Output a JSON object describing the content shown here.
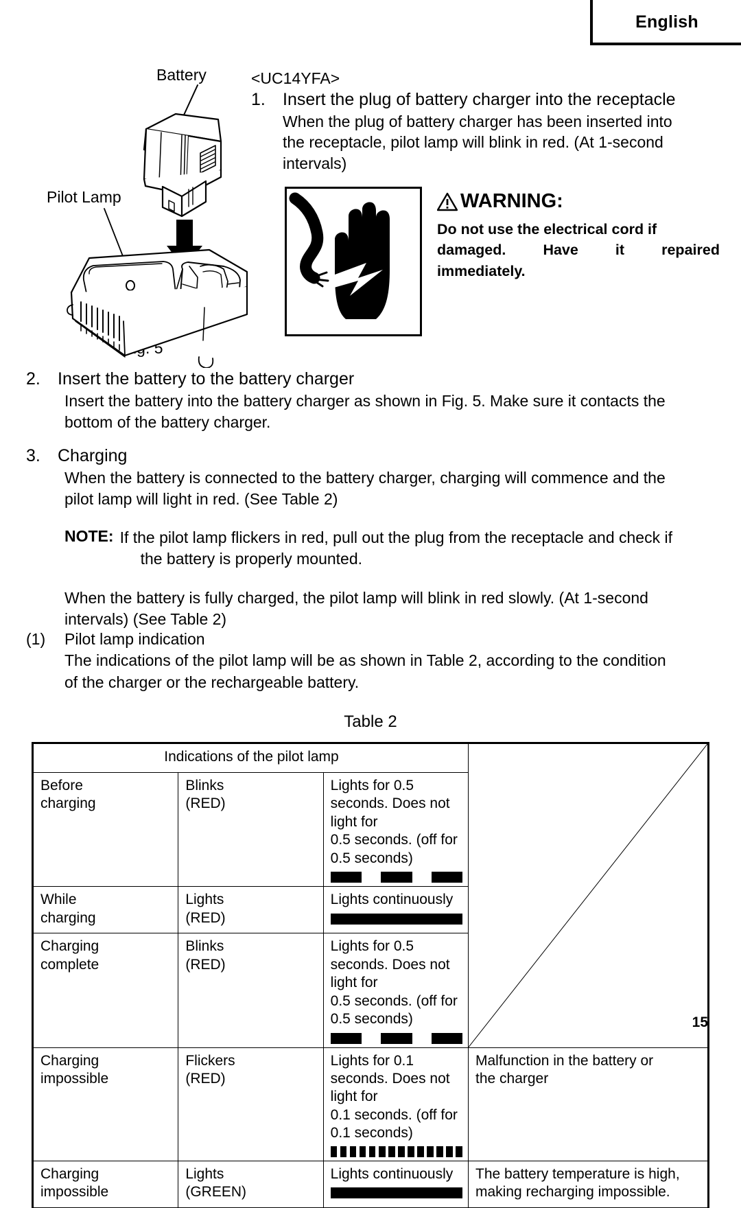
{
  "header": {
    "language_tab": "English"
  },
  "figure": {
    "label_battery": "Battery",
    "label_pilot_lamp": "Pilot Lamp",
    "caption": "Fig. 5"
  },
  "step1": {
    "model": "<UC14YFA>",
    "number": "1.",
    "heading": "Insert the plug of battery charger into the receptacle",
    "body_line1": "When the plug of battery charger has been inserted into",
    "body_line2": "the receptacle, pilot lamp will blink in red. (At 1-second",
    "body_line3": "intervals)"
  },
  "warning": {
    "icon_name": "electrical-shock-hand-icon",
    "title": "WARNING:",
    "line1": "Do not use the electrical cord if",
    "line2_a": "damaged.",
    "line2_b": "Have",
    "line2_c": "it",
    "line2_d": "repaired",
    "line3": "immediately."
  },
  "step2": {
    "number": "2.",
    "heading": "Insert the battery to the battery charger",
    "body_line1": "Insert the battery into the battery charger as shown in Fig. 5. Make sure it contacts the",
    "body_line2": "bottom of the battery charger."
  },
  "step3": {
    "number": "3.",
    "heading": "Charging",
    "body_line1": "When the battery is connected to the battery charger, charging will commence and the",
    "body_line2": "pilot lamp will light in red. (See Table 2)",
    "note_label": "NOTE:",
    "note_line1": "If the pilot lamp flickers in red, pull out the plug from the receptacle and check if",
    "note_line2": "the battery is properly mounted.",
    "after_line1": "When the battery is fully charged, the pilot lamp will blink in red slowly. (At 1-second",
    "after_line2": "intervals) (See Table 2)"
  },
  "substep1": {
    "number": "(1)",
    "heading": "Pilot lamp indication",
    "body_line1": "The indications of the pilot lamp will be as shown in Table 2, according to the condition",
    "body_line2": "of the charger or the rechargeable battery."
  },
  "table": {
    "title": "Table 2",
    "header": "Indications of the pilot lamp",
    "rows": [
      {
        "state_line1": "Before",
        "state_line2": "charging",
        "mode_line1": "Blinks",
        "mode_line2": "(RED)",
        "desc_line1": "Lights for 0.5 seconds. Does not light for",
        "desc_line2": "0.5 seconds. (off for 0.5 seconds)",
        "pattern": "blink",
        "note": ""
      },
      {
        "state_line1": "While",
        "state_line2": "charging",
        "mode_line1": "Lights",
        "mode_line2": "(RED)",
        "desc_line1": "Lights continuously",
        "desc_line2": "",
        "pattern": "continuous",
        "note": ""
      },
      {
        "state_line1": "Charging",
        "state_line2": "complete",
        "mode_line1": "Blinks",
        "mode_line2": "(RED)",
        "desc_line1": "Lights for 0.5 seconds. Does not light for",
        "desc_line2": "0.5 seconds. (off for 0.5 seconds)",
        "pattern": "blink",
        "note": ""
      },
      {
        "state_line1": "Charging",
        "state_line2": "impossible",
        "mode_line1": "Flickers",
        "mode_line2": "(RED)",
        "desc_line1": "Lights for 0.1 seconds. Does not light for",
        "desc_line2": "0.1 seconds. (off for 0.1 seconds)",
        "pattern": "flicker",
        "note_line1": "Malfunction in the battery or",
        "note_line2": "the charger"
      },
      {
        "state_line1": "Charging",
        "state_line2": "impossible",
        "mode_line1": "Lights",
        "mode_line2": "(GREEN)",
        "desc_line1": "Lights continuously",
        "desc_line2": "",
        "pattern": "continuous",
        "note_line1": "The battery temperature is high,",
        "note_line2": "making recharging impossible."
      }
    ]
  },
  "footer": {
    "page_number": "15"
  }
}
